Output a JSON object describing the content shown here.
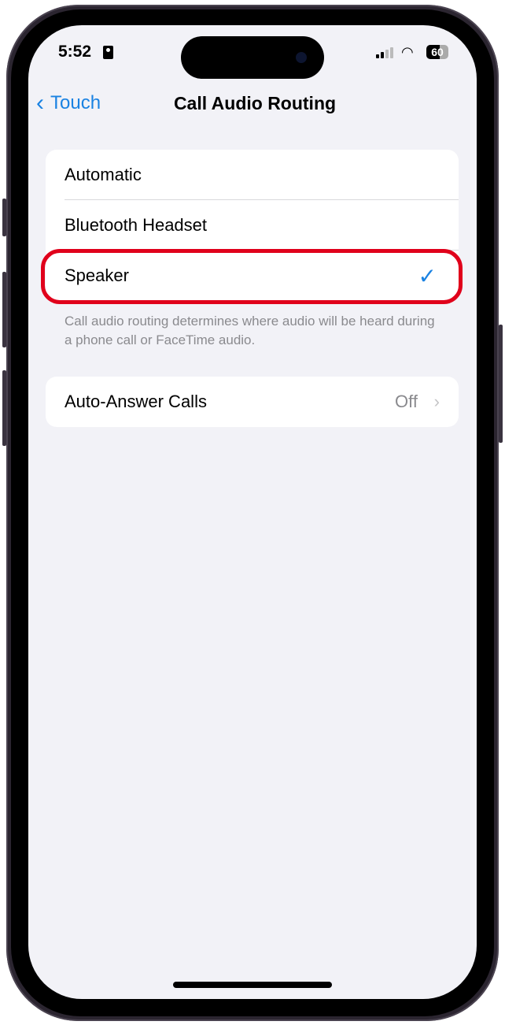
{
  "status_bar": {
    "time": "5:52",
    "battery_percent": "60",
    "icons": [
      "contact-card-icon",
      "cellular-signal-icon",
      "wifi-icon",
      "battery-icon"
    ]
  },
  "nav": {
    "back_label": "Touch",
    "title": "Call Audio Routing"
  },
  "routing_options": [
    {
      "label": "Automatic",
      "selected": false
    },
    {
      "label": "Bluetooth Headset",
      "selected": false
    },
    {
      "label": "Speaker",
      "selected": true
    }
  ],
  "routing_footer": "Call audio routing determines where audio will be heard during a phone call or FaceTime audio.",
  "auto_answer": {
    "label": "Auto-Answer Calls",
    "value": "Off"
  },
  "colors": {
    "accent": "#1a82e2",
    "highlight": "#e0001b",
    "background": "#f2f2f7"
  }
}
